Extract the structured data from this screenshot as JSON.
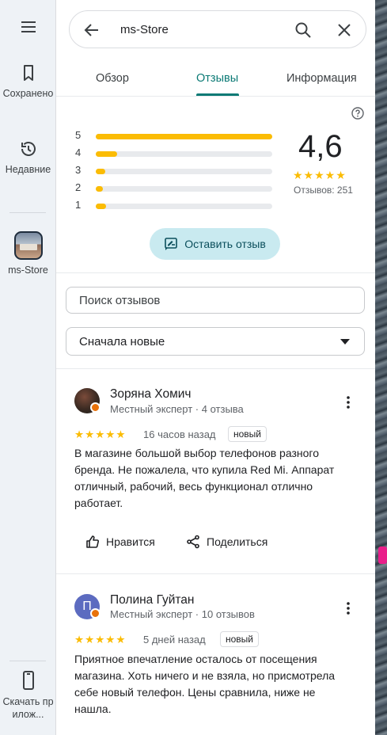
{
  "rail": {
    "saved_label": "Сохранено",
    "recent_label": "Недавние",
    "place_label": "ms-Store",
    "download_label": "Скачать прилож..."
  },
  "search": {
    "query": "ms-Store"
  },
  "tabs": [
    {
      "label": "Обзор",
      "active": false
    },
    {
      "label": "Отзывы",
      "active": true
    },
    {
      "label": "Информация",
      "active": false
    }
  ],
  "rating": {
    "value": "4,6",
    "stars": "★★★★★",
    "count_text": "Отзывов: 251",
    "distribution": [
      {
        "stars": "5",
        "fraction": 1.0
      },
      {
        "stars": "4",
        "fraction": 0.12
      },
      {
        "stars": "3",
        "fraction": 0.055
      },
      {
        "stars": "2",
        "fraction": 0.03
      },
      {
        "stars": "1",
        "fraction": 0.06
      }
    ]
  },
  "write_review_label": "Оставить отзыв",
  "review_search_placeholder": "Поиск отзывов",
  "sort_label": "Сначала новые",
  "reviews": [
    {
      "name": "Зоряна Хомич",
      "meta": "Местный эксперт · 4 отзыва",
      "stars": "★★★★★",
      "when": "16 часов назад",
      "badge": "новый",
      "text": "В магазине большой выбор телефонов разного бренда. Не пожалела, что купила Red Mi. Аппарат отличный, рабочий, весь функционал отлично работает.",
      "like_label": "Нравится",
      "share_label": "Поделиться"
    },
    {
      "name": "Полина Гуйтан",
      "meta": "Местный эксперт · 10 отзывов",
      "avatar_letter": "П",
      "stars": "★★★★★",
      "when": "5 дней назад",
      "badge": "новый",
      "text": "Приятное впечатление осталось от посещения магазина. Хоть ничего и не взяла, но присмотрела себе новый телефон. Цены сравнила, ниже не нашла."
    }
  ],
  "colors": {
    "accent": "#0b7a75",
    "star": "#fbbc04",
    "rail_bg": "#eef2f6",
    "write_btn_bg": "#c9eaf0"
  }
}
